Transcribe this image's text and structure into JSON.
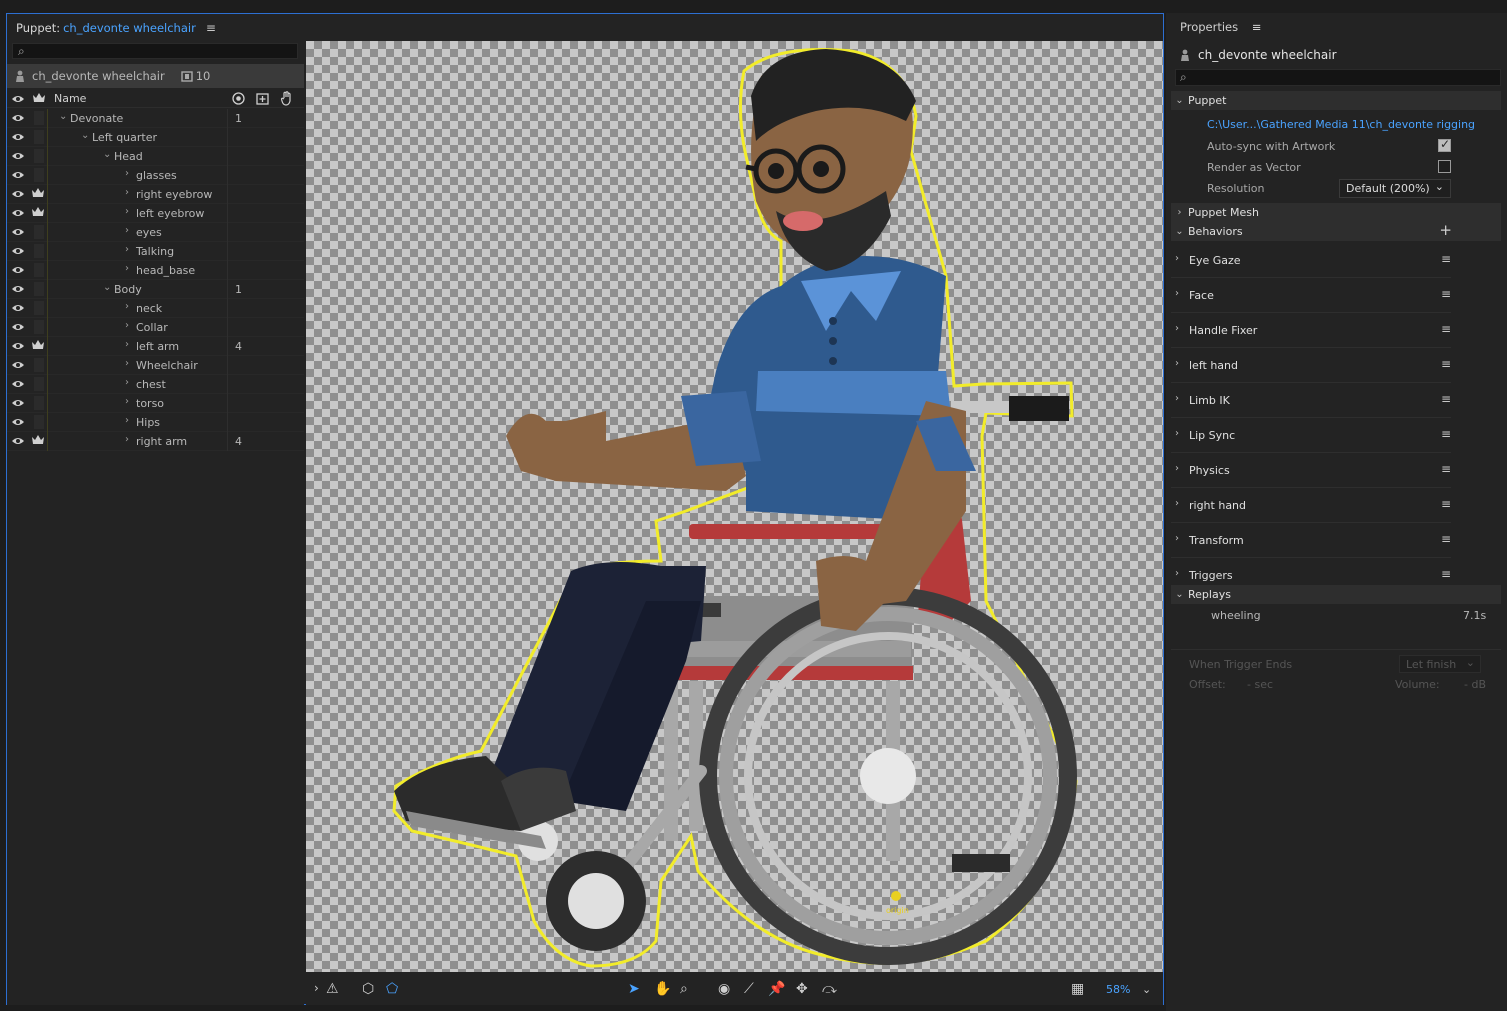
{
  "puppet_panel": {
    "label": "Puppet:",
    "puppet_name": "ch_devonte wheelchair",
    "menu_icon": "hamburger-icon",
    "root_layer": {
      "name": "ch_devonte wheelchair",
      "count": "10"
    },
    "column_header": {
      "name": "Name"
    },
    "layers": [
      {
        "name": "Devonate",
        "indent": 0,
        "expanded": true,
        "tag": "plain",
        "count": "1"
      },
      {
        "name": "Left quarter",
        "indent": 1,
        "expanded": true,
        "tag": "plain",
        "count": ""
      },
      {
        "name": "Head",
        "indent": 2,
        "expanded": true,
        "tag": "plain",
        "count": ""
      },
      {
        "name": "glasses",
        "indent": 3,
        "expanded": false,
        "tag": "plain",
        "count": ""
      },
      {
        "name": "right eyebrow",
        "indent": 3,
        "expanded": false,
        "tag": "crown",
        "count": ""
      },
      {
        "name": "left eyebrow",
        "indent": 3,
        "expanded": false,
        "tag": "crown",
        "count": ""
      },
      {
        "name": "eyes",
        "indent": 3,
        "expanded": false,
        "tag": "plain",
        "count": ""
      },
      {
        "name": "Talking",
        "indent": 3,
        "expanded": false,
        "tag": "plain",
        "count": ""
      },
      {
        "name": "head_base",
        "indent": 3,
        "expanded": false,
        "tag": "plain",
        "count": ""
      },
      {
        "name": "Body",
        "indent": 2,
        "expanded": true,
        "tag": "plain",
        "count": "1"
      },
      {
        "name": "neck",
        "indent": 3,
        "expanded": false,
        "tag": "plain",
        "count": ""
      },
      {
        "name": "Collar",
        "indent": 3,
        "expanded": false,
        "tag": "plain",
        "count": ""
      },
      {
        "name": "left arm",
        "indent": 3,
        "expanded": false,
        "tag": "crown",
        "count": "4"
      },
      {
        "name": "Wheelchair",
        "indent": 3,
        "expanded": false,
        "tag": "plain",
        "count": ""
      },
      {
        "name": "chest",
        "indent": 3,
        "expanded": false,
        "tag": "plain",
        "count": ""
      },
      {
        "name": "torso",
        "indent": 3,
        "expanded": false,
        "tag": "plain",
        "count": ""
      },
      {
        "name": "Hips",
        "indent": 3,
        "expanded": false,
        "tag": "plain",
        "count": ""
      },
      {
        "name": "right arm",
        "indent": 3,
        "expanded": false,
        "tag": "crown",
        "count": "4"
      }
    ],
    "stage": {
      "origin_label": "origin"
    },
    "toolbar": {
      "zoom": "58%"
    }
  },
  "properties": {
    "title": "Properties",
    "puppet_name": "ch_devonte wheelchair",
    "sections": {
      "puppet": "Puppet",
      "puppet_mesh": "Puppet Mesh",
      "behaviors": "Behaviors",
      "replays": "Replays"
    },
    "puppet": {
      "path": "C:\\User...\\Gathered Media 11\\ch_devonte rigging",
      "auto_sync_label": "Auto-sync with Artwork",
      "auto_sync_checked": true,
      "render_vector_label": "Render as Vector",
      "render_vector_checked": false,
      "resolution_label": "Resolution",
      "resolution_value": "Default (200%)"
    },
    "behaviors": [
      "Eye Gaze",
      "Face",
      "Handle Fixer",
      "left hand",
      "Limb IK",
      "Lip Sync",
      "Physics",
      "right hand",
      "Transform",
      "Triggers"
    ],
    "replays": [
      {
        "name": "wheeling",
        "duration": "7.1s"
      }
    ],
    "trigger": {
      "when_ends_label": "When Trigger Ends",
      "when_ends_value": "Let finish",
      "offset_label": "Offset:",
      "offset_value": "- sec",
      "volume_label": "Volume:",
      "volume_value": "- dB"
    }
  },
  "colors": {
    "accent": "#4aa3ff",
    "outline": "#f2ec2a",
    "panel": "#232323"
  }
}
